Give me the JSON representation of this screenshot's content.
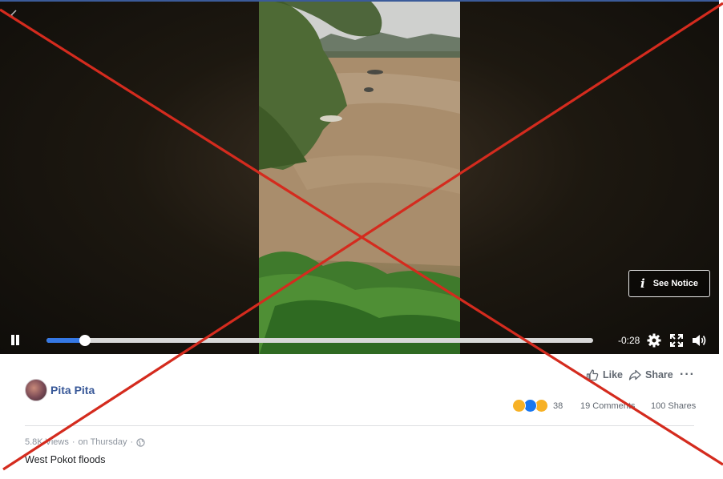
{
  "video": {
    "notice_label": "See Notice",
    "time_remaining": "-0:28",
    "progress_fraction": 0.07
  },
  "icons": {
    "back": "chevron-left-icon",
    "info": "info-icon",
    "pause": "pause-icon",
    "settings": "gear-icon",
    "fullscreen": "fullscreen-icon",
    "volume": "volume-icon",
    "like": "thumbs-up-icon",
    "share": "share-arrow-icon",
    "more": "more-dots-icon",
    "privacy": "globe-icon"
  },
  "post": {
    "author": "Pita Pita",
    "like_label": "Like",
    "share_label": "Share",
    "more_label": "···",
    "reaction_count": "38",
    "comments": "19 Comments",
    "shares": "100 Shares",
    "views": "5.8K Views",
    "separator": "·",
    "posted": "on Thursday",
    "caption": "West Pokot floods"
  },
  "colors": {
    "link_blue": "#385898",
    "progress_blue": "#3578e5",
    "cross_red": "#d42b1e"
  }
}
